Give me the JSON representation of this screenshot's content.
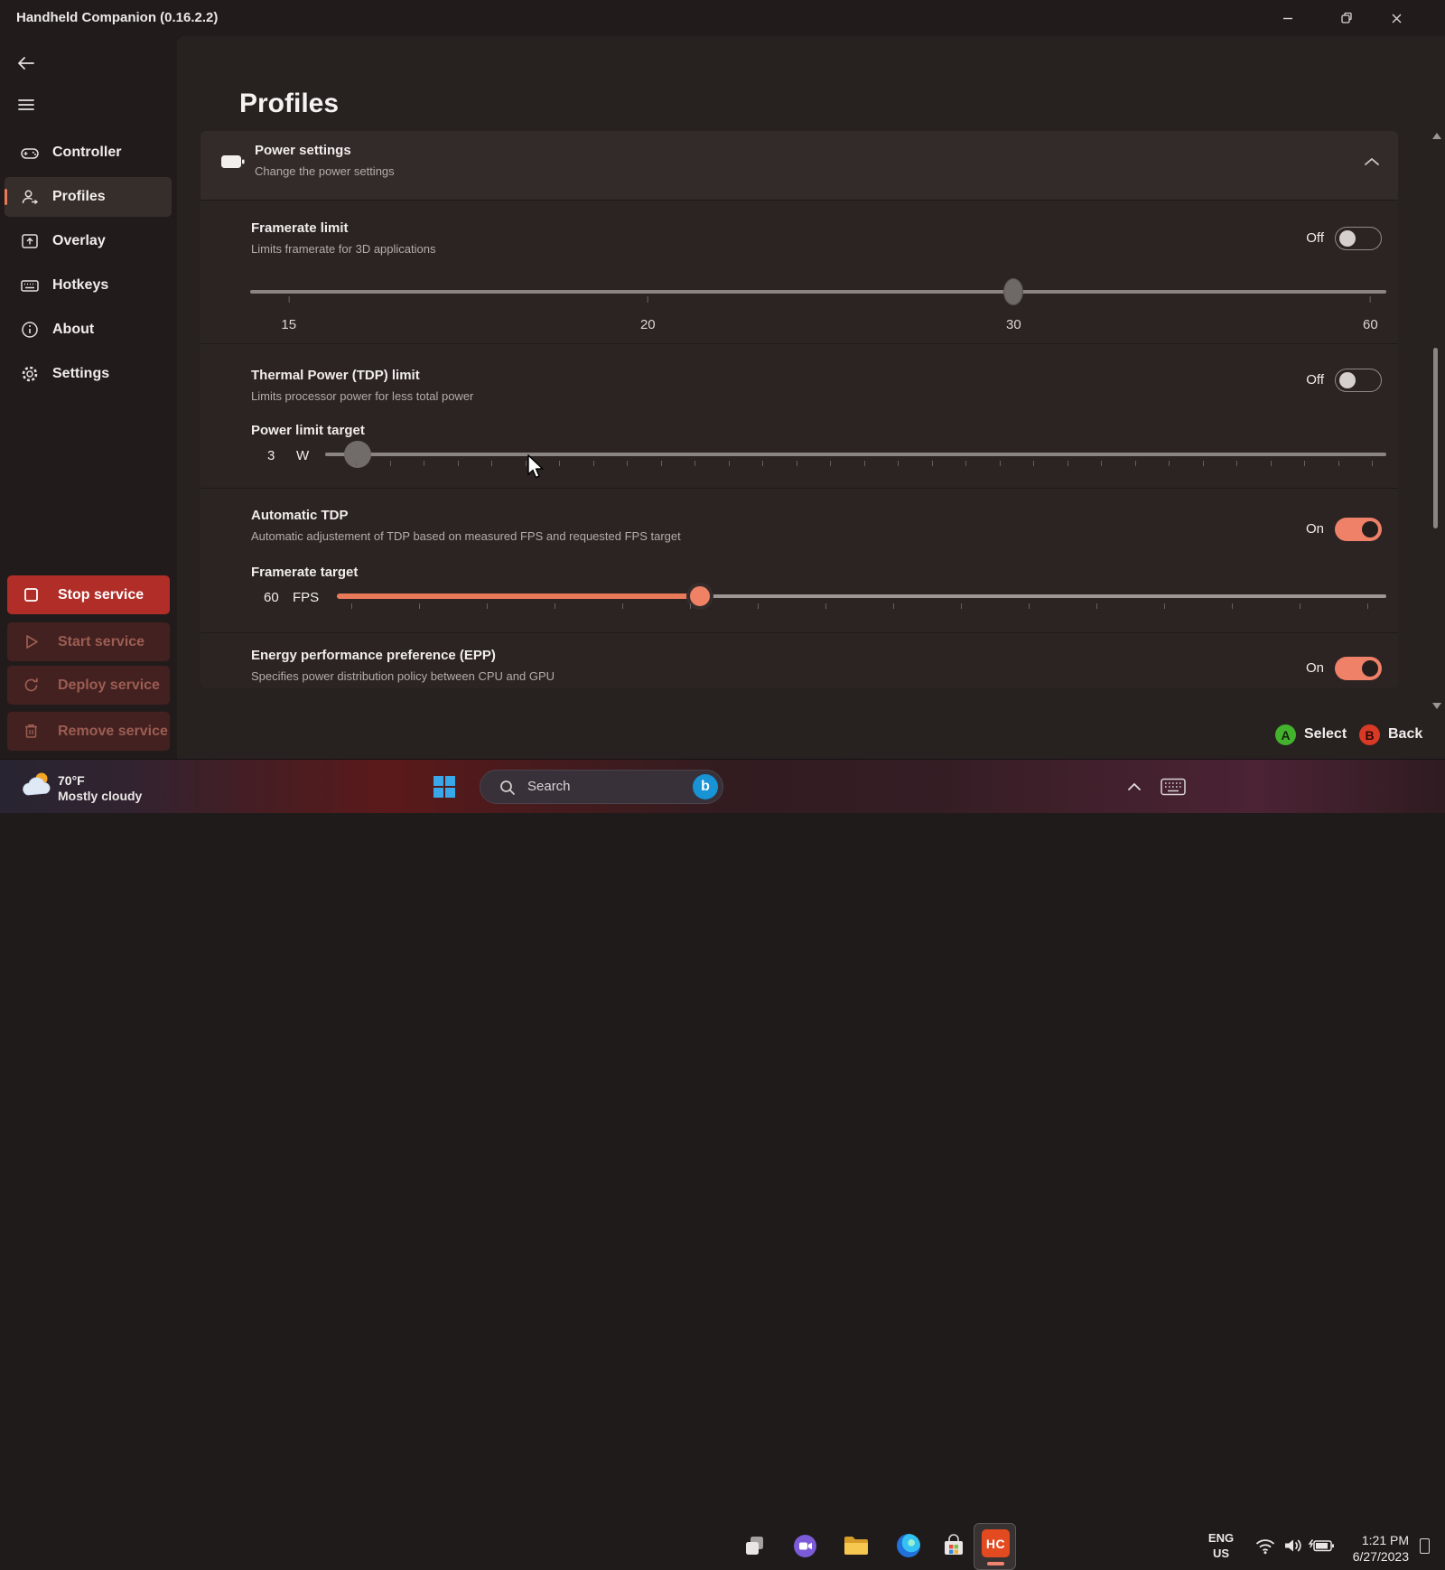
{
  "window": {
    "title": "Handheld Companion (0.16.2.2)"
  },
  "sidebar": {
    "nav": [
      {
        "label": "Controller",
        "icon": "gamepad-icon",
        "selected": false
      },
      {
        "label": "Profiles",
        "icon": "profiles-icon",
        "selected": true
      },
      {
        "label": "Overlay",
        "icon": "overlay-icon",
        "selected": false
      },
      {
        "label": "Hotkeys",
        "icon": "keyboard-icon",
        "selected": false
      },
      {
        "label": "About",
        "icon": "info-icon",
        "selected": false
      },
      {
        "label": "Settings",
        "icon": "gear-icon",
        "selected": false
      }
    ],
    "services": [
      {
        "label": "Stop service",
        "icon": "stop-icon",
        "enabled": true
      },
      {
        "label": "Start service",
        "icon": "play-icon",
        "enabled": false
      },
      {
        "label": "Deploy service",
        "icon": "refresh-icon",
        "enabled": false
      },
      {
        "label": "Remove service",
        "icon": "trash-icon",
        "enabled": false
      }
    ]
  },
  "page": {
    "title": "Profiles",
    "section_header": {
      "title": "Power settings",
      "subtitle": "Change the power settings",
      "icon": "battery-icon",
      "expanded": true
    },
    "settings": {
      "framerate_limit": {
        "title": "Framerate limit",
        "subtitle": "Limits framerate for 3D applications",
        "toggle": "Off",
        "tick_labels": [
          "15",
          "20",
          "30",
          "60"
        ]
      },
      "tdp_limit": {
        "title": "Thermal Power (TDP) limit",
        "subtitle": "Limits processor power for less total power",
        "toggle": "Off"
      },
      "power_limit_target": {
        "label": "Power limit target",
        "value": "3",
        "unit": "W"
      },
      "auto_tdp": {
        "title": "Automatic TDP",
        "subtitle": "Automatic adjustement of TDP based on measured FPS and requested FPS target",
        "toggle": "On"
      },
      "framerate_target": {
        "label": "Framerate target",
        "value": "60",
        "unit": "FPS"
      },
      "epp": {
        "title": "Energy performance preference (EPP)",
        "subtitle": "Specifies power distribution policy between CPU and GPU",
        "toggle": "On"
      }
    },
    "hints": [
      {
        "button": "A",
        "label": "Select",
        "color": "#43b22c"
      },
      {
        "button": "B",
        "label": "Back",
        "color": "#d83a26"
      }
    ]
  },
  "taskbar": {
    "weather": {
      "temp": "70°F",
      "condition": "Mostly cloudy"
    },
    "search": {
      "placeholder": "Search",
      "bing_label": "b"
    },
    "apps": {
      "hc_label": "HC"
    },
    "tray": {
      "lang_line1": "ENG",
      "lang_line2": "US",
      "time": "1:21 PM",
      "date": "6/27/2023"
    }
  },
  "colors": {
    "accent": "#e8795a",
    "toggle_on": "#ee8168",
    "service_stop": "#b12d28",
    "hint_a": "#43b22c",
    "hint_b": "#d83a26"
  }
}
